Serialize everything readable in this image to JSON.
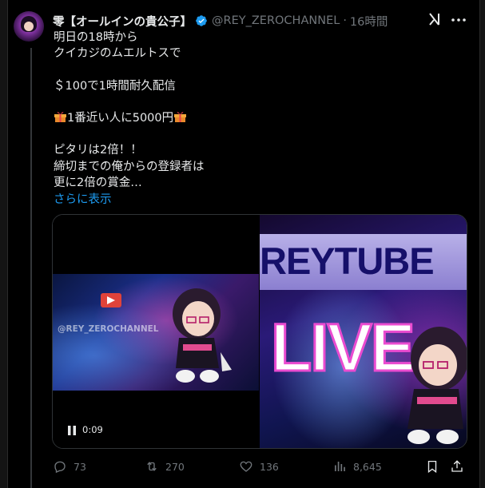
{
  "tweet": {
    "display_name": "零【オールインの貴公子】",
    "handle": "@REY_ZEROCHANNEL",
    "separator": "·",
    "time": "16時間",
    "lines": [
      "明日の18時から",
      "クイカジのムエルトスで",
      "",
      "＄100で1時間耐久配信",
      "",
      "1番近い人に5000円",
      "",
      "ピタリは2倍！！",
      "締切までの俺からの登録者は",
      "更に2倍の賞金…"
    ],
    "show_more": "さらに表示"
  },
  "media": {
    "watermark": "@REY_ZEROCHANNEL",
    "video_time": "0:09",
    "thumb_title": "REYTUBE",
    "thumb_live": "LIVE"
  },
  "actions": {
    "reply_count": "73",
    "retweet_count": "270",
    "like_count": "136",
    "view_count": "8,645"
  },
  "colors": {
    "background": "#000000",
    "text": "#e7e9ea",
    "secondary": "#71767b",
    "link": "#1d9bf0",
    "verified": "#1d9bf0"
  },
  "icons": [
    "verified-badge-icon",
    "grok-icon",
    "more-icon",
    "gift-icon",
    "pause-icon",
    "reply-icon",
    "retweet-icon",
    "like-icon",
    "views-icon",
    "bookmark-icon",
    "share-icon"
  ]
}
